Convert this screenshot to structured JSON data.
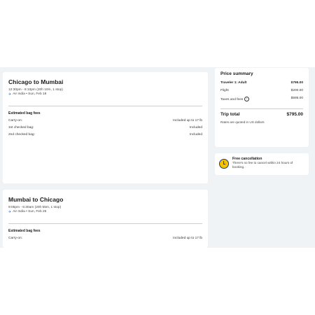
{
  "flights": [
    {
      "route": "Chicago to Mumbai",
      "times": "12:30pm - 8:10pm (20h 10m, 1 stop)",
      "airline": "Air India • Sun, Feb 18",
      "bag_fees_title": "Estimated bag fees",
      "bags": [
        {
          "label": "Carry-on:",
          "value": "Included up to 17 lb"
        },
        {
          "label": "1st checked bag:",
          "value": "Included"
        },
        {
          "label": "2nd checked bag:",
          "value": "Included"
        }
      ]
    },
    {
      "route": "Mumbai to Chicago",
      "times": "9:05pm - 6:30am (20h 55m, 1 stop)",
      "airline": "Air India • Sun, Feb 25",
      "bag_fees_title": "Estimated bag fees",
      "bags": [
        {
          "label": "Carry-on:",
          "value": "Included up to 17 lb"
        }
      ]
    }
  ],
  "summary": {
    "title": "Price summary",
    "traveler_label": "Traveler 1: Adult",
    "traveler_price": "$795.00",
    "flight_label": "Flight",
    "flight_price": "$200.00",
    "taxes_label": "Taxes and fees",
    "taxes_price": "$595.00",
    "total_label": "Trip total",
    "total_price": "$795.00",
    "note": "Rates are quoted in US dollars"
  },
  "cancellation": {
    "title": "Free cancellation",
    "text": "There's no fee to cancel within 24 hours of booking."
  },
  "icons": {
    "plane": "plane-icon",
    "info": "info-icon",
    "clock": "clock-icon"
  },
  "colors": {
    "background": "#eff3f6",
    "clock_fill": "#f5c400",
    "clock_stroke": "#1f3a6e"
  }
}
